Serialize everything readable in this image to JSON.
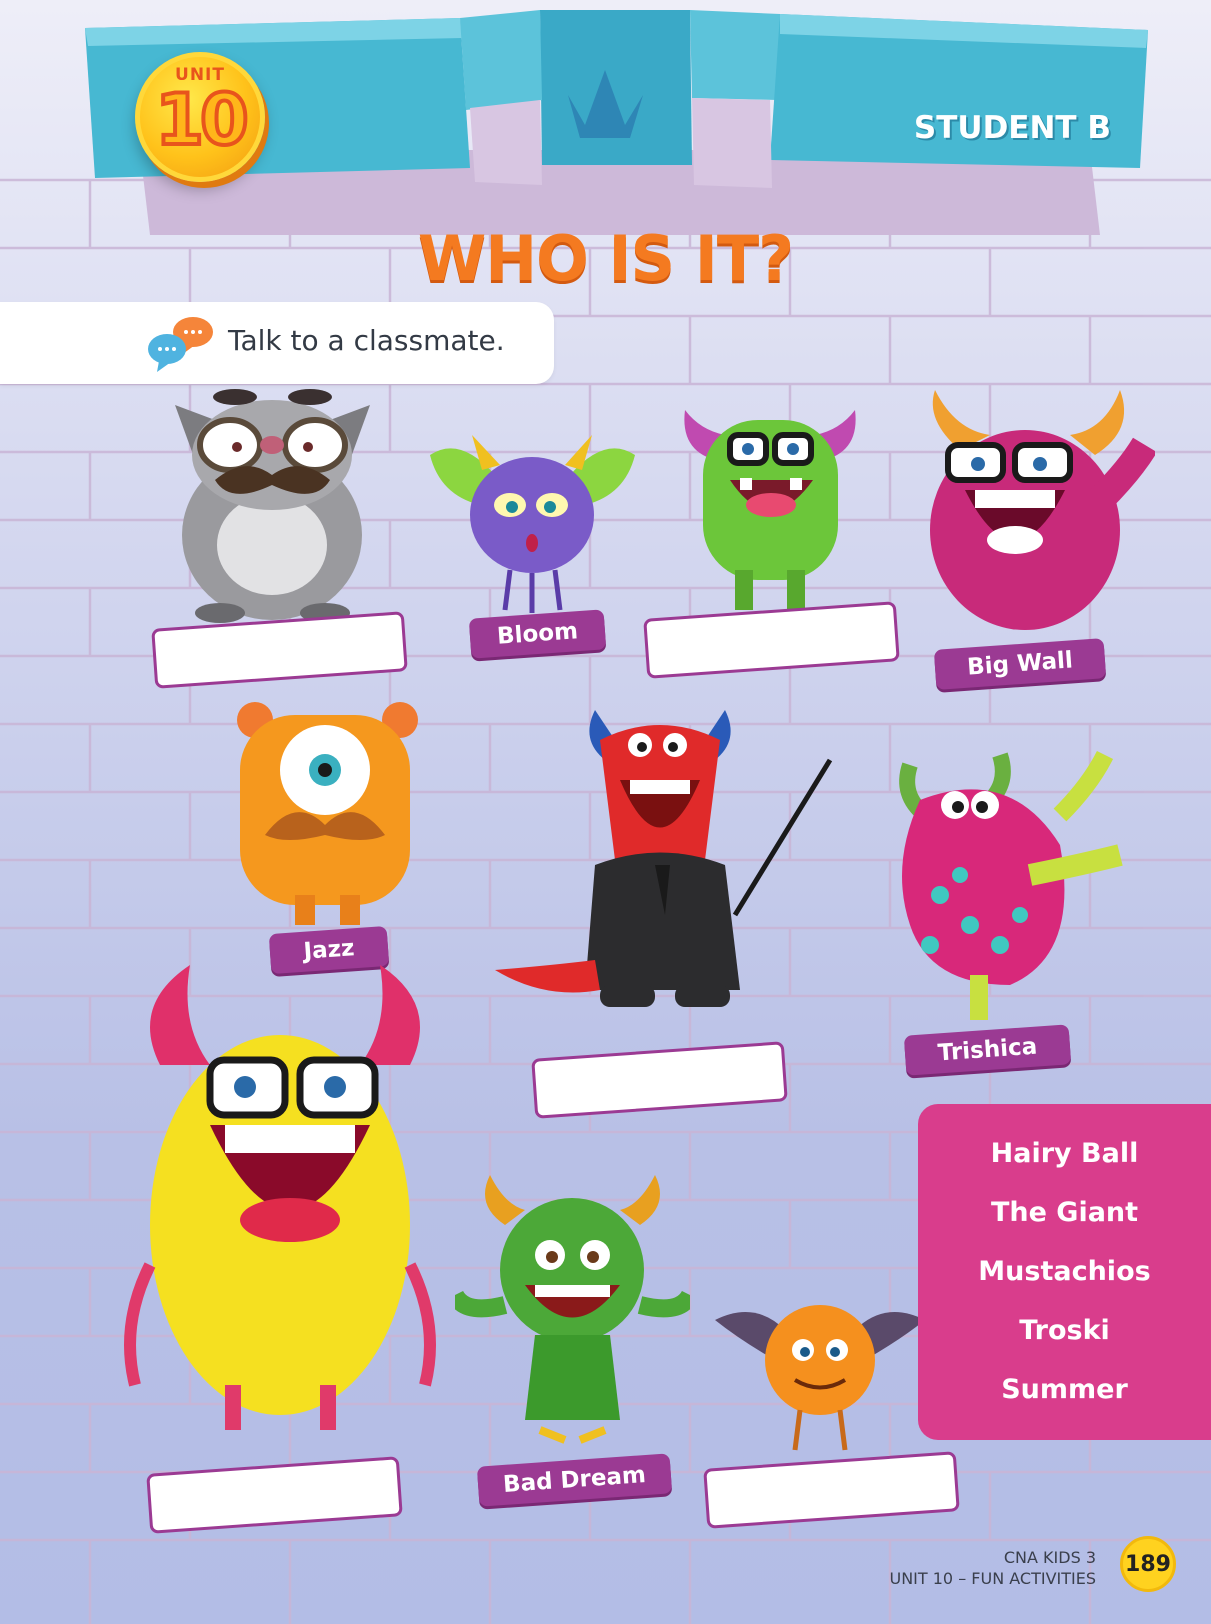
{
  "header": {
    "unit_word": "UNIT",
    "unit_number": "10",
    "student_label": "STUDENT B",
    "title": "WHO IS IT?"
  },
  "instruction": {
    "icon": "speech-bubbles-icon",
    "text": "Talk to a classmate."
  },
  "monsters": {
    "bloom": "Bloom",
    "big_wall": "Big Wall",
    "jazz": "Jazz",
    "trishica": "Trishica",
    "bad_dream": "Bad Dream"
  },
  "word_bank": [
    "Hairy Ball",
    "The Giant",
    "Mustachios",
    "Troski",
    "Summer"
  ],
  "footer": {
    "line1": "CNA KIDS 3",
    "line2": "UNIT 10 – FUN ACTIVITIES",
    "page_number": "189"
  },
  "colors": {
    "title": "#f47a20",
    "tag": "#9b3a93",
    "word_bank": "#d93d8c",
    "banner": "#3fb3d0"
  }
}
